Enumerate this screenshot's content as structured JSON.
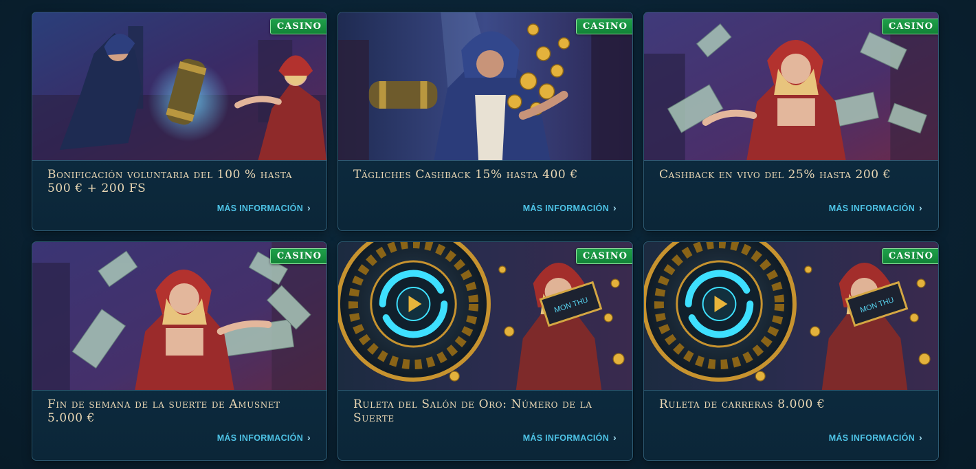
{
  "promotions": [
    {
      "badge": "CASINO",
      "title": "Bonificación voluntaria del 100 % hasta 500 € + 200 FS",
      "more": "MÁS INFORMACIÓN",
      "art": "rogue-and-redhood-bonus",
      "palette": [
        "#27356d",
        "#3c2a63",
        "#b03a2e"
      ]
    },
    {
      "badge": "CASINO",
      "title": "Tägliches Cashback 15% hasta 400 €",
      "more": "MÁS INFORMACIÓN",
      "art": "hooded-rogue-coins",
      "palette": [
        "#2a2f5e",
        "#1f3c6a",
        "#d9a53a"
      ]
    },
    {
      "badge": "CASINO",
      "title": "Cashback en vivo del 25% hasta 200 €",
      "more": "MÁS INFORMACIÓN",
      "art": "redhood-banknotes",
      "palette": [
        "#3a2a6a",
        "#4a3477",
        "#b3322e"
      ]
    },
    {
      "badge": "CASINO",
      "title": "Fin de semana de la suerte de Amusnet 5.000 €",
      "more": "MÁS INFORMACIÓN",
      "art": "redhood-banknotes",
      "palette": [
        "#35285f",
        "#432f6b",
        "#b3322e"
      ]
    },
    {
      "badge": "CASINO",
      "title": "Ruleta del Salón de Oro: Número de la Suerte",
      "more": "MÁS INFORMACIÓN",
      "art": "wheel-redhood-ticket",
      "palette": [
        "#1b2f45",
        "#2d2a52",
        "#c7932f"
      ]
    },
    {
      "badge": "CASINO",
      "title": "Ruleta de carreras 8.000 €",
      "more": "MÁS INFORMACIÓN",
      "art": "wheel-redhood-ticket",
      "palette": [
        "#1b2f45",
        "#2d2a52",
        "#c7932f"
      ]
    }
  ],
  "ticket_text": "MON THU",
  "icons": {
    "more": "chevron-right-icon"
  },
  "colors": {
    "accent": "#4ec3e6",
    "badge": "#1a9a45",
    "title": "#e9d7b4",
    "border": "#2d5a72"
  }
}
